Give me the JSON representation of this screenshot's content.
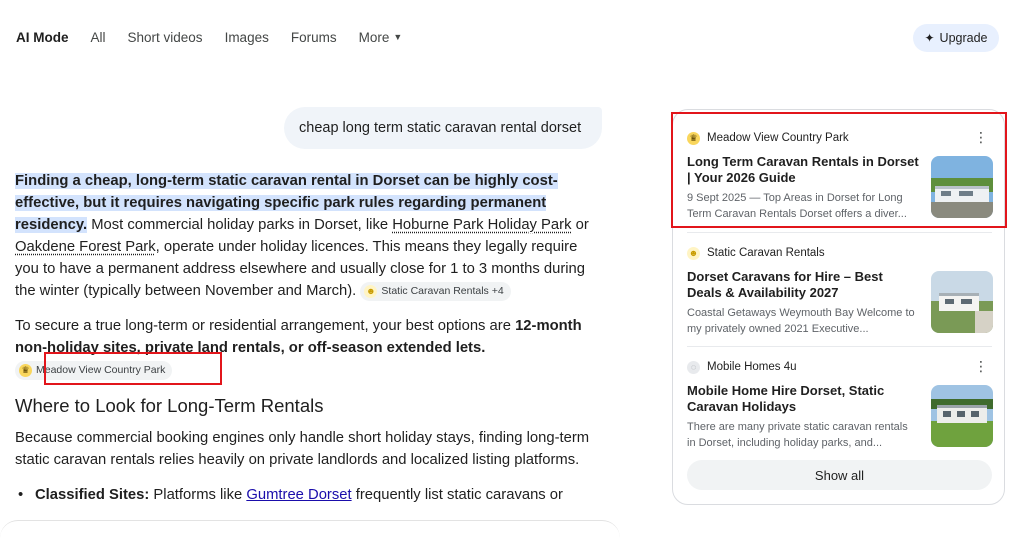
{
  "nav": {
    "tabs": [
      {
        "label": "AI Mode",
        "active": true
      },
      {
        "label": "All"
      },
      {
        "label": "Short videos"
      },
      {
        "label": "Images"
      },
      {
        "label": "Forums"
      },
      {
        "label": "More"
      }
    ],
    "upgrade_label": "Upgrade"
  },
  "query": "cheap long term static caravan rental dorset",
  "answer": {
    "p1_highlight": "Finding a cheap, long-term static caravan rental in Dorset can be highly cost-effective, but it requires navigating specific park rules regarding permanent residency.",
    "p1_a": " Most commercial holiday parks in Dorset, like ",
    "p1_link1": "Hoburne Park Holiday Park",
    "p1_b": " or ",
    "p1_link2": "Oakdene Forest Park",
    "p1_c": ", operate under holiday licences. This means they legally require you to have a permanent address elsewhere and usually close for 1 to 3 months during the winter (typically between November and March). ",
    "p1_chip": "Static Caravan Rentals +4",
    "p2_a": "To secure a true long-term or residential arrangement, your best options are ",
    "p2_bold": "12-month non-holiday sites, private land rentals, or off-season extended lets.",
    "p2_chip": "Meadow View Country Park",
    "h2": "Where to Look for Long-Term Rentals",
    "p3": "Because commercial booking engines only handle short holiday stays, finding long-term static caravan rentals relies heavily on private landlords and localized listing platforms.",
    "li1_bold": "Classified Sites:",
    "li1_a": " Platforms like ",
    "li1_link": "Gumtree Dorset",
    "li1_b": " frequently list static caravans or"
  },
  "sources": [
    {
      "site": "Meadow View Country Park",
      "title": "Long Term Caravan Rentals in Dorset | Your 2026 Guide",
      "snippet": "9 Sept 2025 — Top Areas in Dorset for Long Term Caravan Rentals Dorset offers a diver...",
      "favicon": "fav-yellow"
    },
    {
      "site": "Static Caravan Rentals",
      "title": "Dorset Caravans for Hire – Best Deals & Availability 2027",
      "snippet": "Coastal Getaways Weymouth Bay Welcome to my privately owned 2021 Executive...",
      "favicon": "fav-sun"
    },
    {
      "site": "Mobile Homes 4u",
      "title": "Mobile Home Hire Dorset, Static Caravan Holidays",
      "snippet": "There are many private static caravan rentals in Dorset, including holiday parks, and...",
      "favicon": "fav-grey"
    }
  ],
  "show_all_label": "Show all",
  "colors": {
    "highlight": "#d3e3fd",
    "annotation_red": "#e2151b",
    "link_blue": "#1a0dab",
    "upgrade_bg": "#e8f0fe"
  }
}
